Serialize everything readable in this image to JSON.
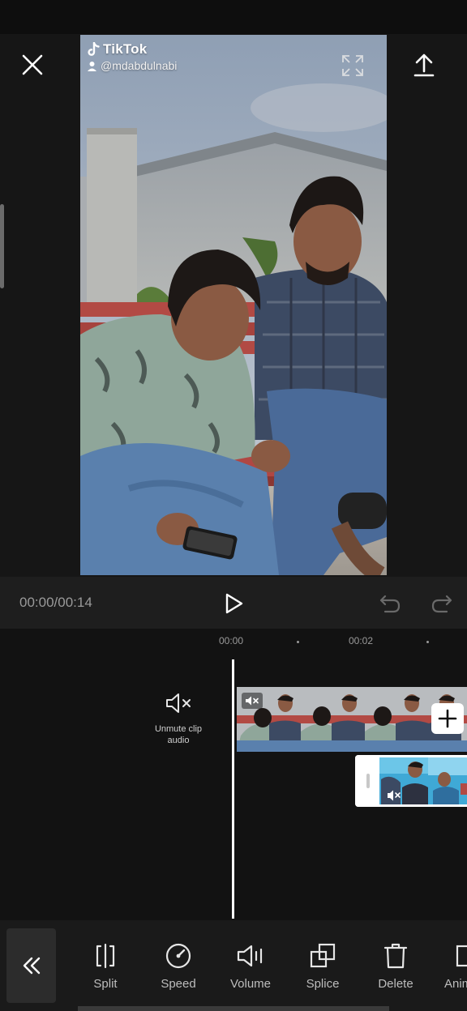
{
  "watermark": {
    "brand": "TikTok",
    "username": "@mdabdulnabi"
  },
  "playback": {
    "time": "00:00/00:14"
  },
  "timeline": {
    "ruler": [
      "00:00",
      "00:02"
    ],
    "unmute_label_line1": "Unmute clip",
    "unmute_label_line2": "audio"
  },
  "toolbar": {
    "tools": [
      {
        "label": "Split",
        "icon": "split-icon"
      },
      {
        "label": "Speed",
        "icon": "speed-icon"
      },
      {
        "label": "Volume",
        "icon": "volume-icon"
      },
      {
        "label": "Splice",
        "icon": "splice-icon"
      },
      {
        "label": "Delete",
        "icon": "delete-icon"
      },
      {
        "label": "Anim",
        "icon": "animation-icon"
      }
    ]
  },
  "colors": {
    "background": "#121212",
    "panel": "#1e1e1e",
    "text_muted": "#9a9a9a",
    "accent": "#ffffff"
  }
}
